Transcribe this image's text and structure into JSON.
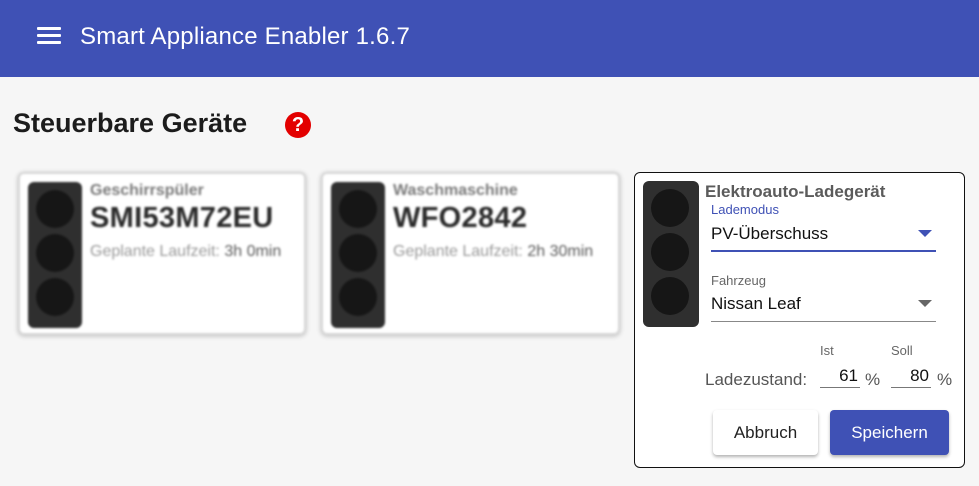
{
  "app": {
    "title": "Smart Appliance Enabler 1.6.7"
  },
  "page": {
    "title": "Steuerbare Geräte",
    "help_glyph": "?"
  },
  "colors": {
    "primary": "#3f51b5",
    "help": "#e30000"
  },
  "devices": [
    {
      "type": "Geschirrspüler",
      "model": "SMI53M72EU",
      "runtime_label": "Geplante Laufzeit:",
      "runtime_value": "3h 0min"
    },
    {
      "type": "Waschmaschine",
      "model": "WFO2842",
      "runtime_label": "Geplante Laufzeit:",
      "runtime_value": "2h 30min"
    }
  ],
  "ev_charger": {
    "type": "Elektroauto-Ladegerät",
    "mode_label": "Lademodus",
    "mode_value": "PV-Überschuss",
    "vehicle_label": "Fahrzeug",
    "vehicle_value": "Nissan Leaf",
    "soc_label": "Ladezustand:",
    "soc_current_label": "Ist",
    "soc_current_value": "61",
    "soc_target_label": "Soll",
    "soc_target_value": "80",
    "percent": "%",
    "cancel_label": "Abbruch",
    "save_label": "Speichern"
  }
}
